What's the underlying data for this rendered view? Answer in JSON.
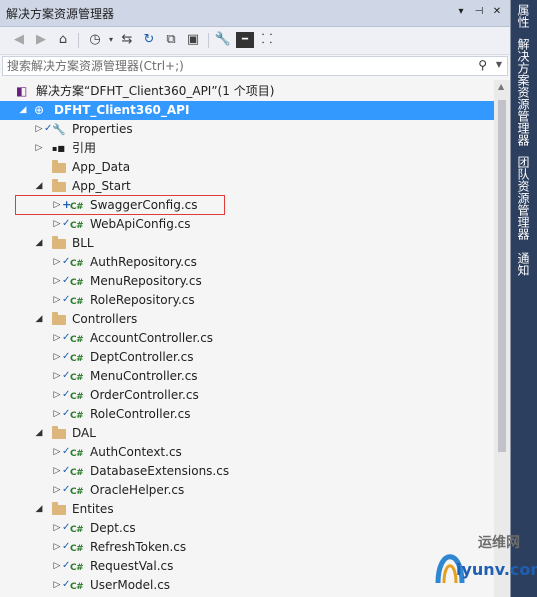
{
  "window": {
    "title": "解决方案资源管理器",
    "title_buttons": [
      "▾",
      "⊣",
      "✕"
    ]
  },
  "toolbar": {
    "icons": [
      "back-icon",
      "forward-icon",
      "home-icon",
      "history-icon",
      "sync-icon",
      "refresh-icon",
      "collapse-all-icon",
      "show-all-files-icon",
      "properties-icon",
      "preview-icon",
      "class-view-icon"
    ]
  },
  "search": {
    "placeholder": "搜索解决方案资源管理器(Ctrl+;)"
  },
  "side_tabs": [
    "属性",
    "解决方案资源管理器",
    "团队资源管理器",
    "通知"
  ],
  "tree": {
    "solution": "解决方案“DFHT_Client360_API”(1 个项目)",
    "project": "DFHT_Client360_API",
    "items": [
      {
        "label": "Properties",
        "kind": "properties",
        "indent": 1,
        "arrow": "closed",
        "check": true
      },
      {
        "label": "引用",
        "kind": "references",
        "indent": 1,
        "arrow": "closed",
        "check": false
      },
      {
        "label": "App_Data",
        "kind": "folder",
        "indent": 1,
        "arrow": "none",
        "check": false
      },
      {
        "label": "App_Start",
        "kind": "folder",
        "indent": 1,
        "arrow": "open",
        "check": false
      },
      {
        "label": "SwaggerConfig.cs",
        "kind": "cs",
        "indent": 2,
        "arrow": "closed",
        "check": false,
        "plus": true
      },
      {
        "label": "WebApiConfig.cs",
        "kind": "cs",
        "indent": 2,
        "arrow": "closed",
        "check": true
      },
      {
        "label": "BLL",
        "kind": "folder",
        "indent": 1,
        "arrow": "open",
        "check": false
      },
      {
        "label": "AuthRepository.cs",
        "kind": "cs",
        "indent": 2,
        "arrow": "closed",
        "check": true
      },
      {
        "label": "MenuRepository.cs",
        "kind": "cs",
        "indent": 2,
        "arrow": "closed",
        "check": true
      },
      {
        "label": "RoleRepository.cs",
        "kind": "cs",
        "indent": 2,
        "arrow": "closed",
        "check": true
      },
      {
        "label": "Controllers",
        "kind": "folder",
        "indent": 1,
        "arrow": "open",
        "check": false
      },
      {
        "label": "AccountController.cs",
        "kind": "cs",
        "indent": 2,
        "arrow": "closed",
        "check": true
      },
      {
        "label": "DeptController.cs",
        "kind": "cs",
        "indent": 2,
        "arrow": "closed",
        "check": true
      },
      {
        "label": "MenuController.cs",
        "kind": "cs",
        "indent": 2,
        "arrow": "closed",
        "check": true
      },
      {
        "label": "OrderController.cs",
        "kind": "cs",
        "indent": 2,
        "arrow": "closed",
        "check": true
      },
      {
        "label": "RoleController.cs",
        "kind": "cs",
        "indent": 2,
        "arrow": "closed",
        "check": true
      },
      {
        "label": "DAL",
        "kind": "folder",
        "indent": 1,
        "arrow": "open",
        "check": false
      },
      {
        "label": "AuthContext.cs",
        "kind": "cs",
        "indent": 2,
        "arrow": "closed",
        "check": true
      },
      {
        "label": "DatabaseExtensions.cs",
        "kind": "cs",
        "indent": 2,
        "arrow": "closed",
        "check": true
      },
      {
        "label": "OracleHelper.cs",
        "kind": "cs",
        "indent": 2,
        "arrow": "closed",
        "check": true
      },
      {
        "label": "Entites",
        "kind": "folder",
        "indent": 1,
        "arrow": "open",
        "check": false
      },
      {
        "label": "Dept.cs",
        "kind": "cs",
        "indent": 2,
        "arrow": "closed",
        "check": true
      },
      {
        "label": "RefreshToken.cs",
        "kind": "cs",
        "indent": 2,
        "arrow": "closed",
        "check": true
      },
      {
        "label": "RequestVal.cs",
        "kind": "cs",
        "indent": 2,
        "arrow": "closed",
        "check": true
      },
      {
        "label": "UserModel.cs",
        "kind": "cs",
        "indent": 2,
        "arrow": "closed",
        "check": true
      }
    ]
  },
  "watermark": {
    "brand": "运维网",
    "url": "iyunv.com"
  },
  "colors": {
    "selection": "#3399ff",
    "highlight_box": "#e03a3a",
    "side_bar": "#2d3f5e"
  }
}
